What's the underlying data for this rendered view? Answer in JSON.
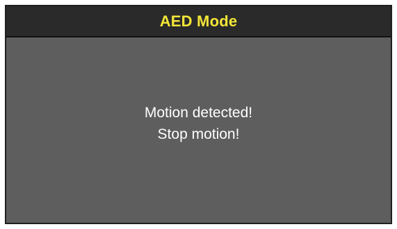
{
  "header": {
    "title": "AED Mode"
  },
  "message": {
    "line1": "Motion detected!",
    "line2": "Stop motion!"
  },
  "colors": {
    "title": "#f4e637",
    "header_background": "#2a2a2a",
    "screen_background": "#5e5e5e",
    "message_text": "#ffffff"
  }
}
